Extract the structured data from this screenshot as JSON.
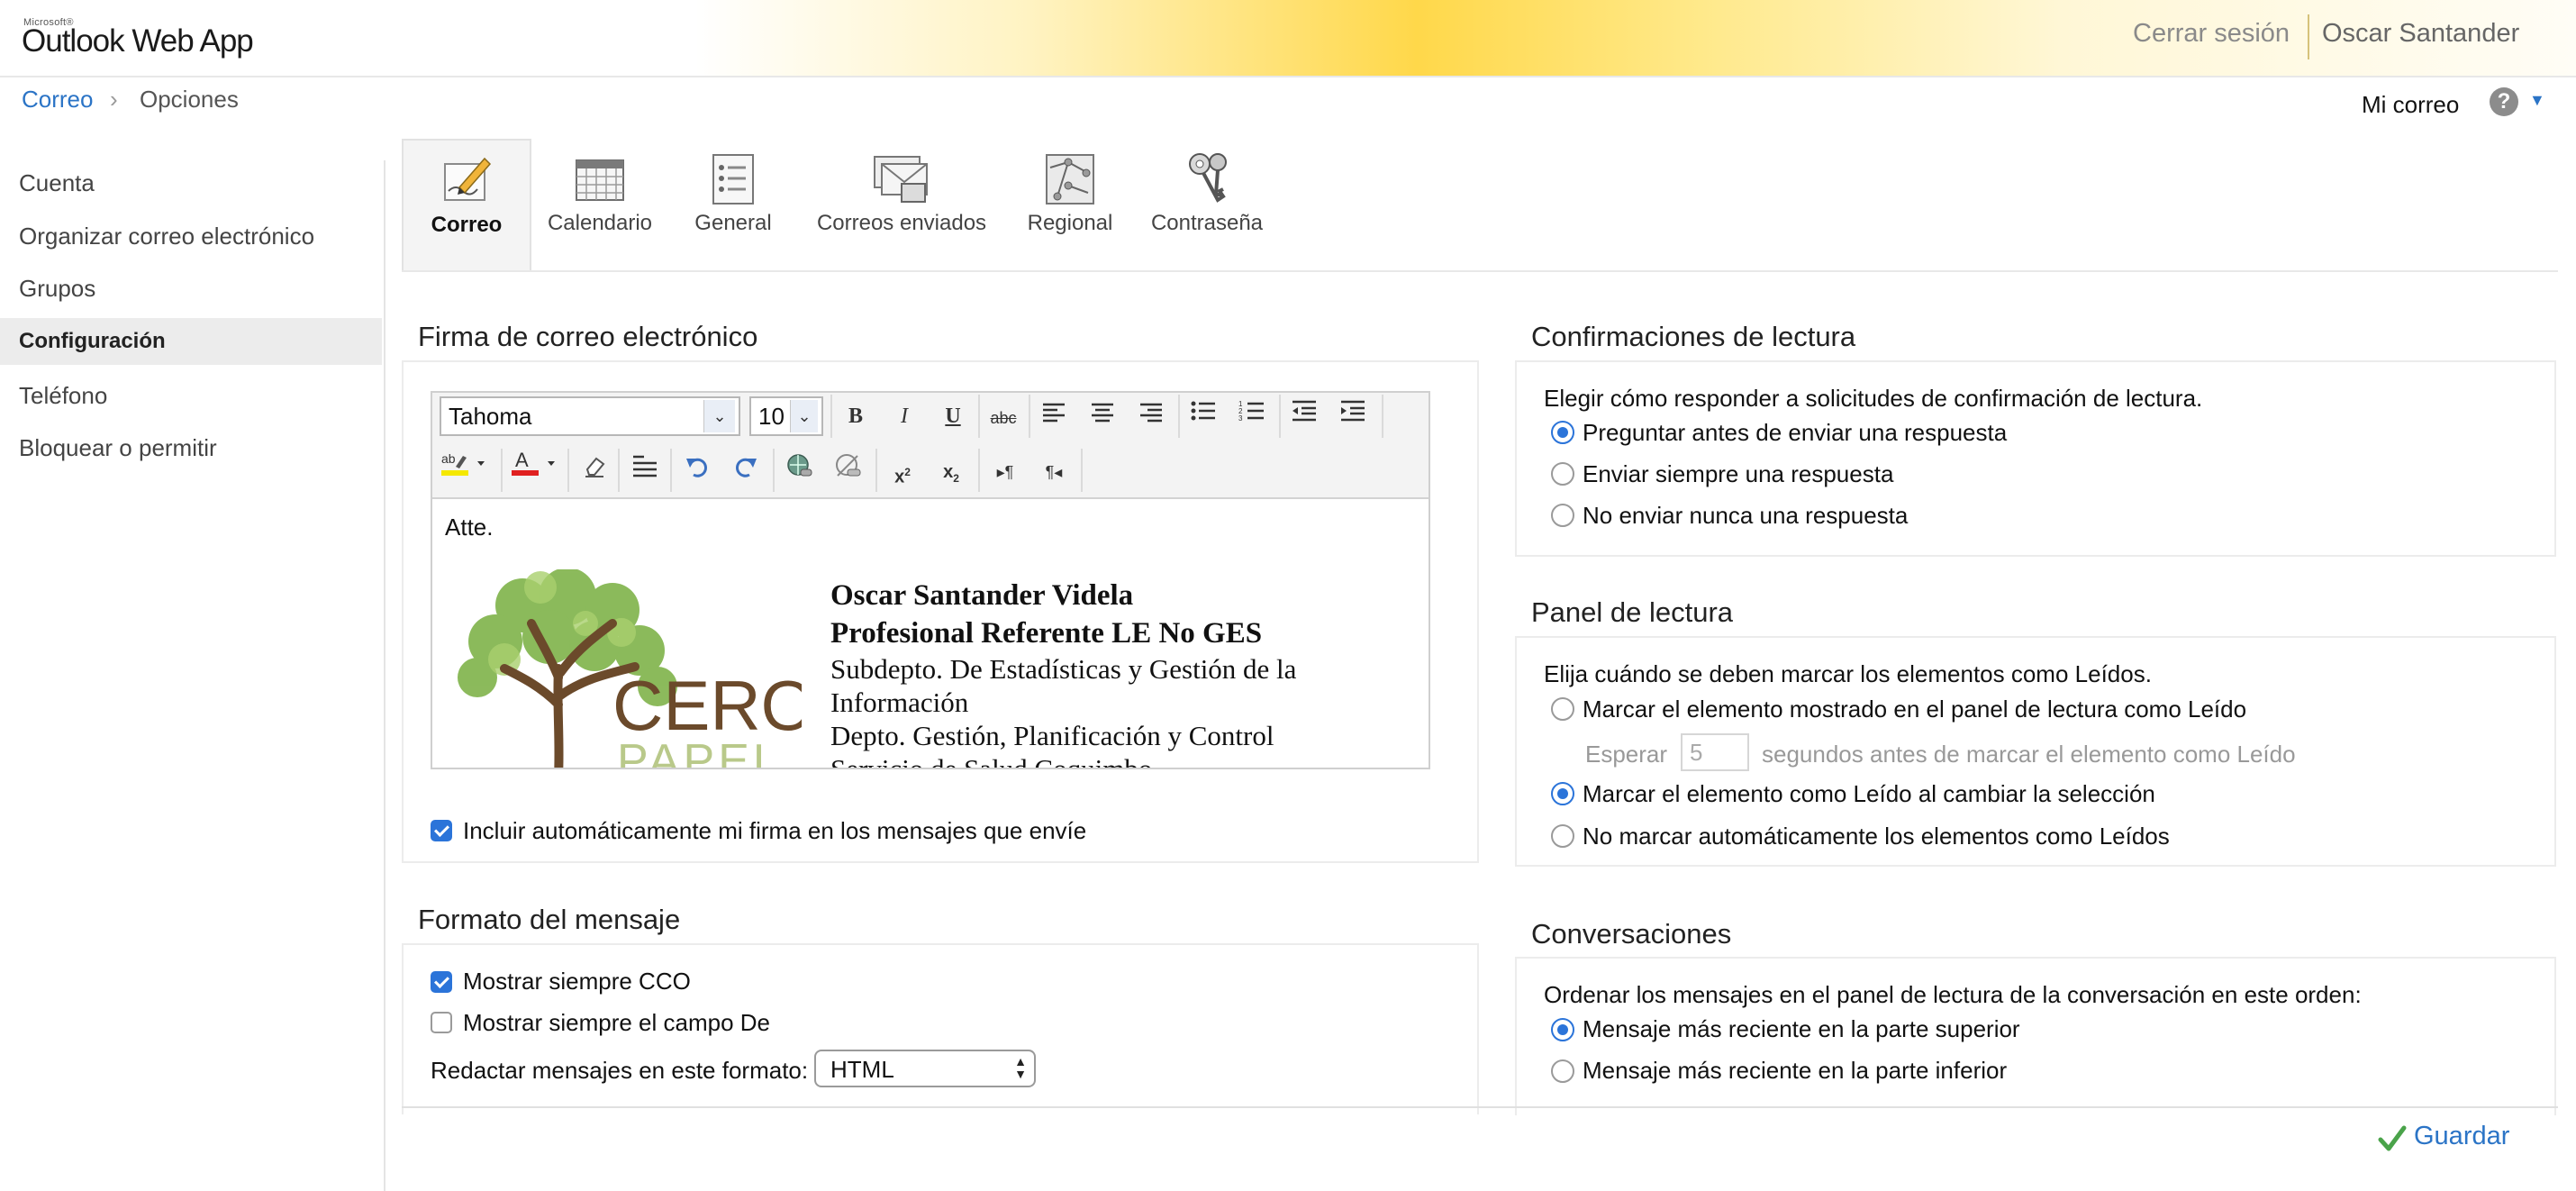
{
  "header": {
    "logo_small": "Microsoft®",
    "logo_main": "Outlook Web App",
    "signout_label": "Cerrar sesión",
    "user_name": "Oscar Santander"
  },
  "breadcrumb": {
    "root": "Correo",
    "separator": "›",
    "current": "Opciones"
  },
  "topbar": {
    "my_mail": "Mi correo",
    "help_glyph": "?"
  },
  "sidebar": {
    "items": [
      {
        "label": "Cuenta"
      },
      {
        "label": "Organizar correo electrónico"
      },
      {
        "label": "Grupos"
      },
      {
        "label": "Configuración",
        "active": true
      },
      {
        "label": "Teléfono"
      },
      {
        "label": "Bloquear o permitir"
      }
    ]
  },
  "tabs": [
    {
      "label": "Correo",
      "icon": "mail-settings-icon",
      "active": true
    },
    {
      "label": "Calendario",
      "icon": "calendar-icon"
    },
    {
      "label": "General",
      "icon": "general-list-icon"
    },
    {
      "label": "Correos enviados",
      "icon": "sent-mail-icon"
    },
    {
      "label": "Regional",
      "icon": "regional-map-icon"
    },
    {
      "label": "Contraseña",
      "icon": "keys-icon"
    }
  ],
  "signature": {
    "title": "Firma de correo electrónico",
    "font": "Tahoma",
    "size": "10",
    "greeting": "Atte.",
    "logo_text_1": "CERO",
    "logo_text_2": "PAPEL",
    "name": "Oscar Santander Videla",
    "role": "Profesional Referente LE No GES",
    "dept_1": "Subdepto. De Estadísticas y Gestión de la",
    "dept_1b": "Información",
    "dept_2": "Depto. Gestión, Planificación y Control",
    "dept_3": "Servicio de Salud Coquimbo",
    "auto_include_label": "Incluir automáticamente mi firma en los mensajes que envíe",
    "auto_include_checked": true
  },
  "format": {
    "title": "Formato del mensaje",
    "always_bcc_label": "Mostrar siempre CCO",
    "always_bcc_checked": true,
    "always_from_label": "Mostrar siempre el campo De",
    "always_from_checked": false,
    "compose_label": "Redactar mensajes en este formato:",
    "compose_value": "HTML"
  },
  "read_receipts": {
    "title": "Confirmaciones de lectura",
    "prompt": "Elegir cómo responder a solicitudes de confirmación de lectura.",
    "options": [
      {
        "label": "Preguntar antes de enviar una respuesta",
        "selected": true
      },
      {
        "label": "Enviar siempre una respuesta",
        "selected": false
      },
      {
        "label": "No enviar nunca una respuesta",
        "selected": false
      }
    ]
  },
  "reading_pane": {
    "title": "Panel de lectura",
    "prompt": "Elija cuándo se deben marcar los elementos como Leídos.",
    "options": [
      {
        "label": "Marcar el elemento mostrado en el panel de lectura como Leído",
        "selected": false
      },
      {
        "label": "Marcar el elemento como Leído al cambiar la selección",
        "selected": true
      },
      {
        "label": "No marcar automáticamente los elementos como Leídos",
        "selected": false
      }
    ],
    "wait_label": "Esperar",
    "wait_value": "5",
    "wait_suffix": "segundos antes de marcar el elemento como Leído"
  },
  "conversations": {
    "title": "Conversaciones",
    "prompt": "Ordenar los mensajes en el panel de lectura de la conversación en este orden:",
    "options": [
      {
        "label": "Mensaje más reciente en la parte superior",
        "selected": true
      },
      {
        "label": "Mensaje más reciente en la parte inferior",
        "selected": false
      }
    ]
  },
  "footer": {
    "save_label": "Guardar"
  },
  "colors": {
    "accent": "#2b74d9",
    "link": "#2b74c6",
    "header_yellow": "#ffd84a"
  }
}
